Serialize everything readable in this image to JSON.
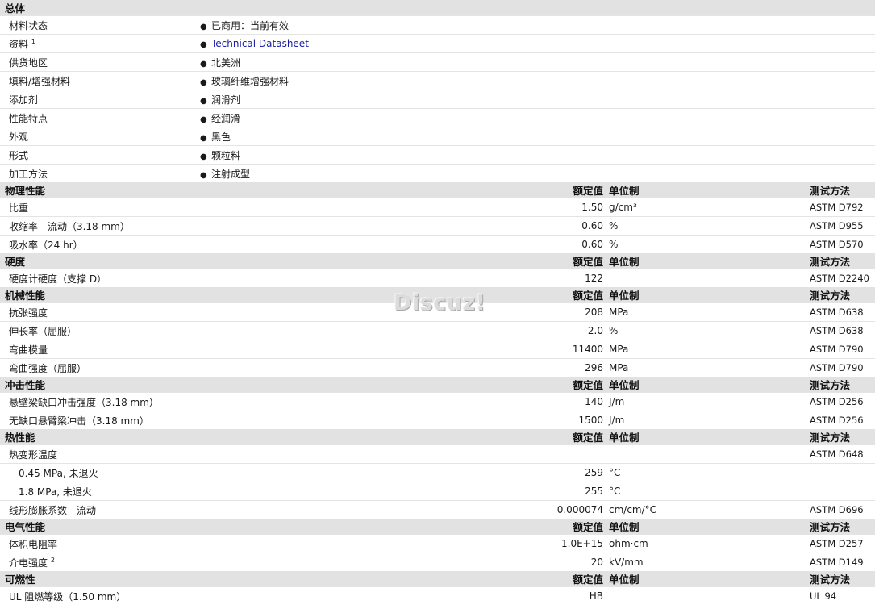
{
  "general": {
    "title": "总体",
    "rows": [
      {
        "label": "材料状态",
        "sup": "",
        "value": "已商用：当前有效",
        "link": false
      },
      {
        "label": "资料",
        "sup": "1",
        "value": "Technical Datasheet",
        "link": true
      },
      {
        "label": "供货地区",
        "sup": "",
        "value": "北美洲",
        "link": false
      },
      {
        "label": "填料/增强材料",
        "sup": "",
        "value": "玻璃纤维增强材料",
        "link": false
      },
      {
        "label": "添加剂",
        "sup": "",
        "value": "润滑剂",
        "link": false
      },
      {
        "label": "性能特点",
        "sup": "",
        "value": "经润滑",
        "link": false
      },
      {
        "label": "外观",
        "sup": "",
        "value": "黑色",
        "link": false
      },
      {
        "label": "形式",
        "sup": "",
        "value": "颗粒料",
        "link": false
      },
      {
        "label": "加工方法",
        "sup": "",
        "value": "注射成型",
        "link": false
      }
    ]
  },
  "columns": {
    "rated": "额定值",
    "unit": "单位制",
    "method": "测试方法"
  },
  "sections": [
    {
      "title": "物理性能",
      "rows": [
        {
          "label": "比重",
          "sup": "",
          "value": "1.50",
          "unit": "g/cm³",
          "method": "ASTM D792"
        },
        {
          "label": "收缩率  - 流动（3.18 mm）",
          "sup": "",
          "value": "0.60",
          "unit": "%",
          "method": "ASTM D955"
        },
        {
          "label": "吸水率（24 hr）",
          "sup": "",
          "value": "0.60",
          "unit": "%",
          "method": "ASTM D570"
        }
      ]
    },
    {
      "title": "硬度",
      "rows": [
        {
          "label": "硬度计硬度（支撑  D）",
          "sup": "",
          "value": "122",
          "unit": "",
          "method": "ASTM D2240"
        }
      ]
    },
    {
      "title": "机械性能",
      "rows": [
        {
          "label": "抗张强度",
          "sup": "",
          "value": "208",
          "unit": "MPa",
          "method": "ASTM D638"
        },
        {
          "label": "伸长率（屈服）",
          "sup": "",
          "value": "2.0",
          "unit": "%",
          "method": "ASTM D638"
        },
        {
          "label": "弯曲模量",
          "sup": "",
          "value": "11400",
          "unit": "MPa",
          "method": "ASTM D790"
        },
        {
          "label": "弯曲强度（屈服）",
          "sup": "",
          "value": "296",
          "unit": "MPa",
          "method": "ASTM D790"
        }
      ]
    },
    {
      "title": "冲击性能",
      "rows": [
        {
          "label": "悬壁梁缺口冲击强度（3.18 mm）",
          "sup": "",
          "value": "140",
          "unit": "J/m",
          "method": "ASTM D256"
        },
        {
          "label": "无缺口悬臂梁冲击（3.18 mm）",
          "sup": "",
          "value": "1500",
          "unit": "J/m",
          "method": "ASTM D256"
        }
      ]
    },
    {
      "title": "热性能",
      "rows": [
        {
          "label": "热变形温度",
          "sup": "",
          "value": "",
          "unit": "",
          "method": "ASTM D648"
        },
        {
          "label": "0.45 MPa, 未退火",
          "sup": "",
          "value": "259",
          "unit": "°C",
          "method": "",
          "sub": true
        },
        {
          "label": "1.8 MPa, 未退火",
          "sup": "",
          "value": "255",
          "unit": "°C",
          "method": "",
          "sub": true
        },
        {
          "label": "线形膨胀系数  - 流动",
          "sup": "",
          "value": "0.000074",
          "unit": "cm/cm/°C",
          "method": "ASTM D696"
        }
      ]
    },
    {
      "title": "电气性能",
      "rows": [
        {
          "label": "体积电阻率",
          "sup": "",
          "value": "1.0E+15",
          "unit": "ohm·cm",
          "method": "ASTM D257"
        },
        {
          "label": "介电强度",
          "sup": "2",
          "value": "20",
          "unit": "kV/mm",
          "method": "ASTM D149"
        }
      ]
    },
    {
      "title": "可燃性",
      "rows": [
        {
          "label": "UL 阻燃等级（1.50 mm）",
          "sup": "",
          "value": "HB",
          "unit": "",
          "method": "UL 94"
        }
      ]
    }
  ],
  "watermark": "Discuz!"
}
